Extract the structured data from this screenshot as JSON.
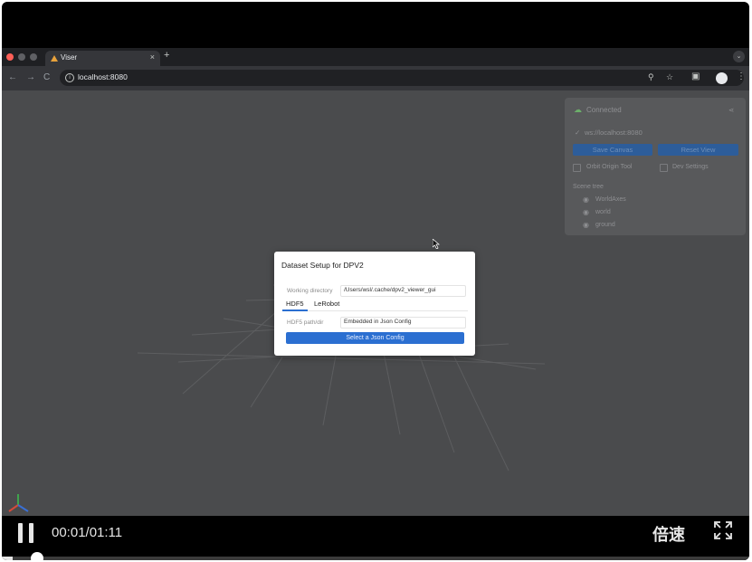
{
  "browser": {
    "tab_title": "Viser",
    "tab_close": "×",
    "new_tab": "+",
    "url": "localhost:8080",
    "nav": {
      "back": "←",
      "forward": "→",
      "reload": "C"
    }
  },
  "panel": {
    "status": "Connected",
    "server": "ws://localhost:8080",
    "save_canvas": "Save Canvas",
    "reset_view": "Reset View",
    "orbit_origin_tool": "Orbit Origin Tool",
    "dev_settings": "Dev Settings",
    "scene_tree_label": "Scene tree",
    "scene_items": [
      "WorldAxes",
      "world",
      "ground"
    ]
  },
  "dialog": {
    "title": "Dataset Setup for DPV2",
    "working_dir_label": "Working directory",
    "working_dir_value": "/Users/wsl/.cache/dpv2_viewer_gui",
    "tabs": [
      "HDF5",
      "LeRobot"
    ],
    "hdf5_path_label": "HDF5 path/dir",
    "hdf5_path_value": "Embedded in Json Config",
    "select_button": "Select a Json Config"
  },
  "player": {
    "time": "00:01/01:11",
    "speed": "倍速",
    "progress": 0.014
  },
  "colors": {
    "accent": "#2b6fd1",
    "viewport_bg": "#4a4b4d",
    "chrome_bg": "#35363a"
  }
}
